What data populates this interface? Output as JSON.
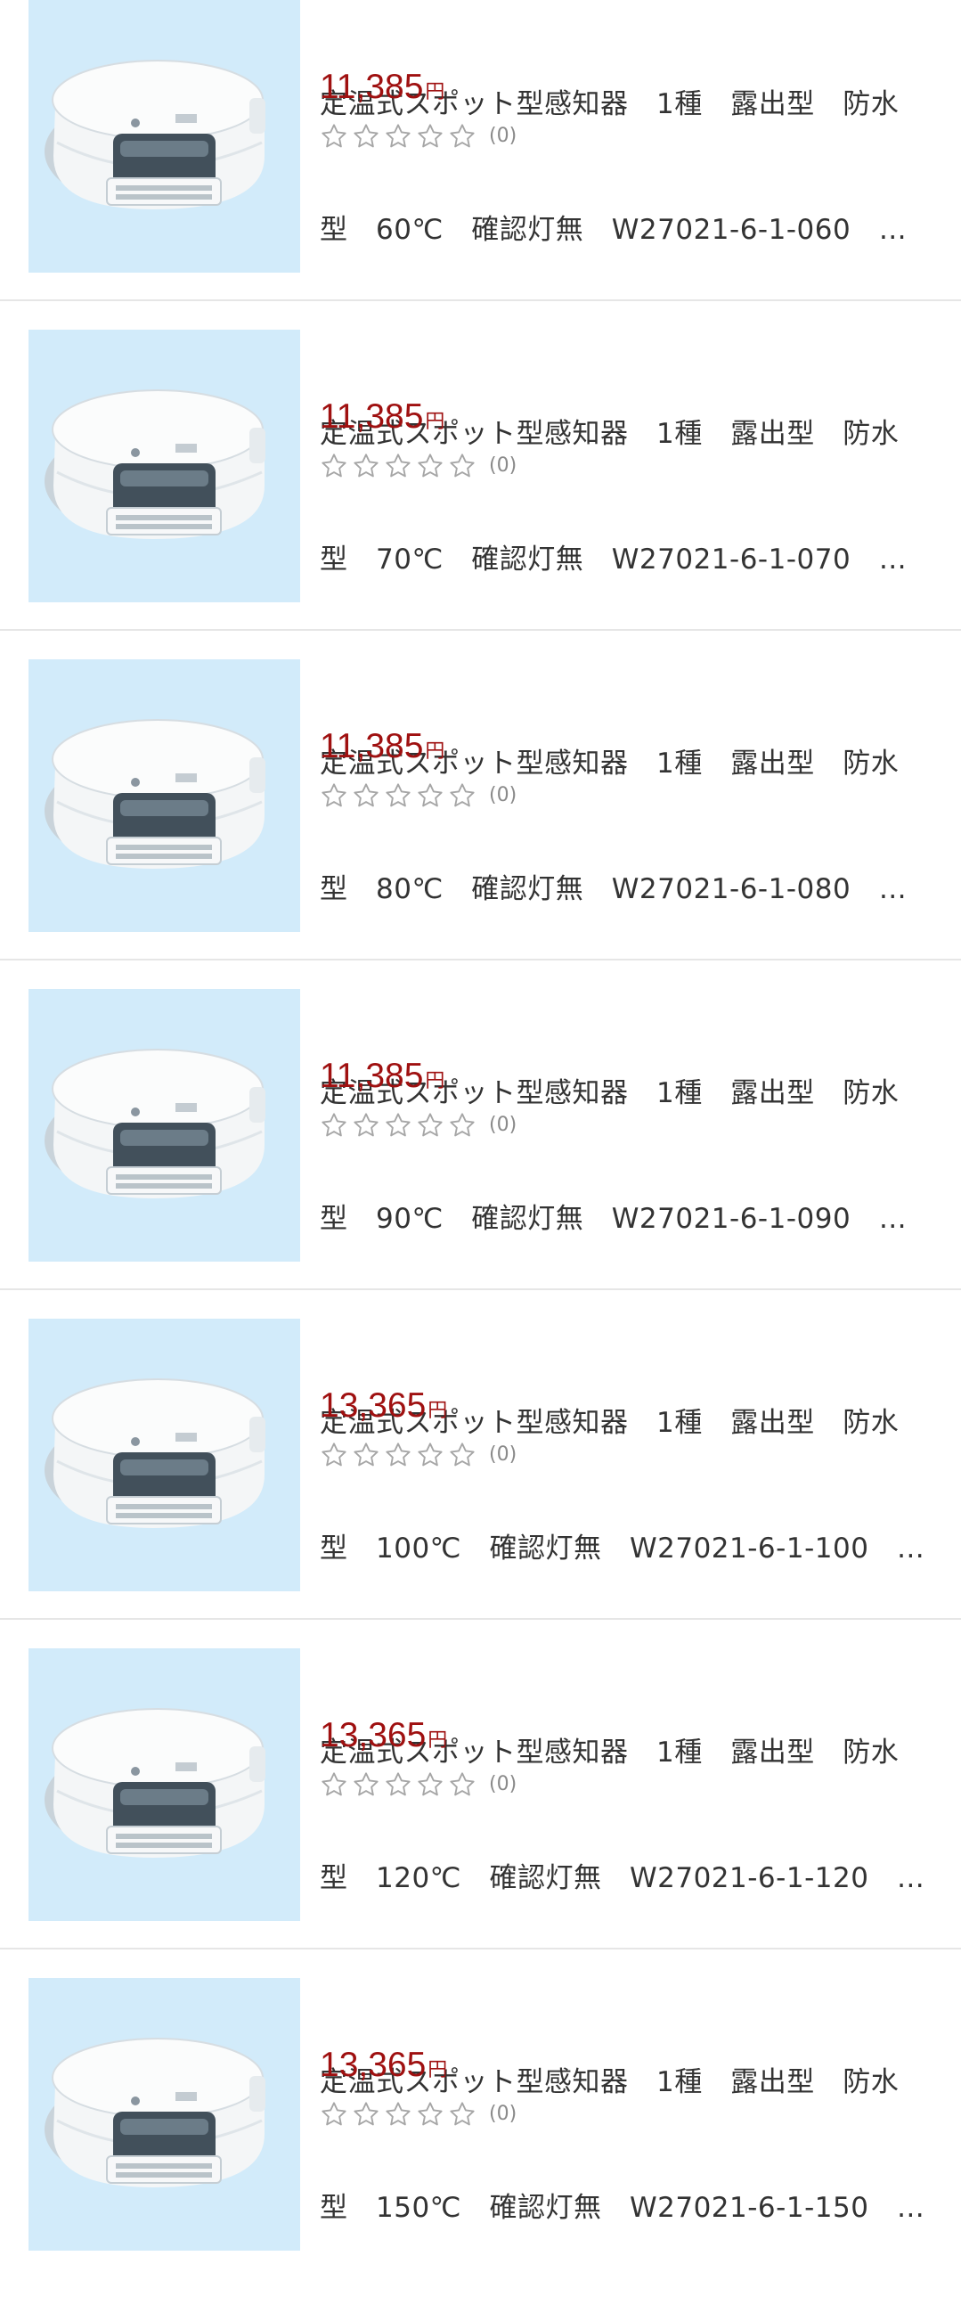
{
  "colors": {
    "price": "#9f1010",
    "thumb_background": "#d2ebfa",
    "divider": "#e6e6e6",
    "star_outline": "#a6a6a6"
  },
  "price_unit": "円",
  "star_icon": "star-outline-icon",
  "products": [
    {
      "title_line1": "定温式スポット型感知器　1種　露出型　防水",
      "title_line2": "型　60℃　確認灯無　W27021-6-1-060　…",
      "price": "11,385",
      "rating_stars": 0,
      "review_count": "(0)"
    },
    {
      "title_line1": "定温式スポット型感知器　1種　露出型　防水",
      "title_line2": "型　70℃　確認灯無　W27021-6-1-070　…",
      "price": "11,385",
      "rating_stars": 0,
      "review_count": "(0)"
    },
    {
      "title_line1": "定温式スポット型感知器　1種　露出型　防水",
      "title_line2": "型　80℃　確認灯無　W27021-6-1-080　…",
      "price": "11,385",
      "rating_stars": 0,
      "review_count": "(0)"
    },
    {
      "title_line1": "定温式スポット型感知器　1種　露出型　防水",
      "title_line2": "型　90℃　確認灯無　W27021-6-1-090　…",
      "price": "11,385",
      "rating_stars": 0,
      "review_count": "(0)"
    },
    {
      "title_line1": "定温式スポット型感知器　1種　露出型　防水",
      "title_line2": "型　100℃　確認灯無　W27021-6-1-100　…",
      "price": "13,365",
      "rating_stars": 0,
      "review_count": "(0)"
    },
    {
      "title_line1": "定温式スポット型感知器　1種　露出型　防水",
      "title_line2": "型　120℃　確認灯無　W27021-6-1-120　…",
      "price": "13,365",
      "rating_stars": 0,
      "review_count": "(0)"
    },
    {
      "title_line1": "定温式スポット型感知器　1種　露出型　防水",
      "title_line2": "型　150℃　確認灯無　W27021-6-1-150　…",
      "price": "13,365",
      "rating_stars": 0,
      "review_count": "(0)"
    }
  ]
}
